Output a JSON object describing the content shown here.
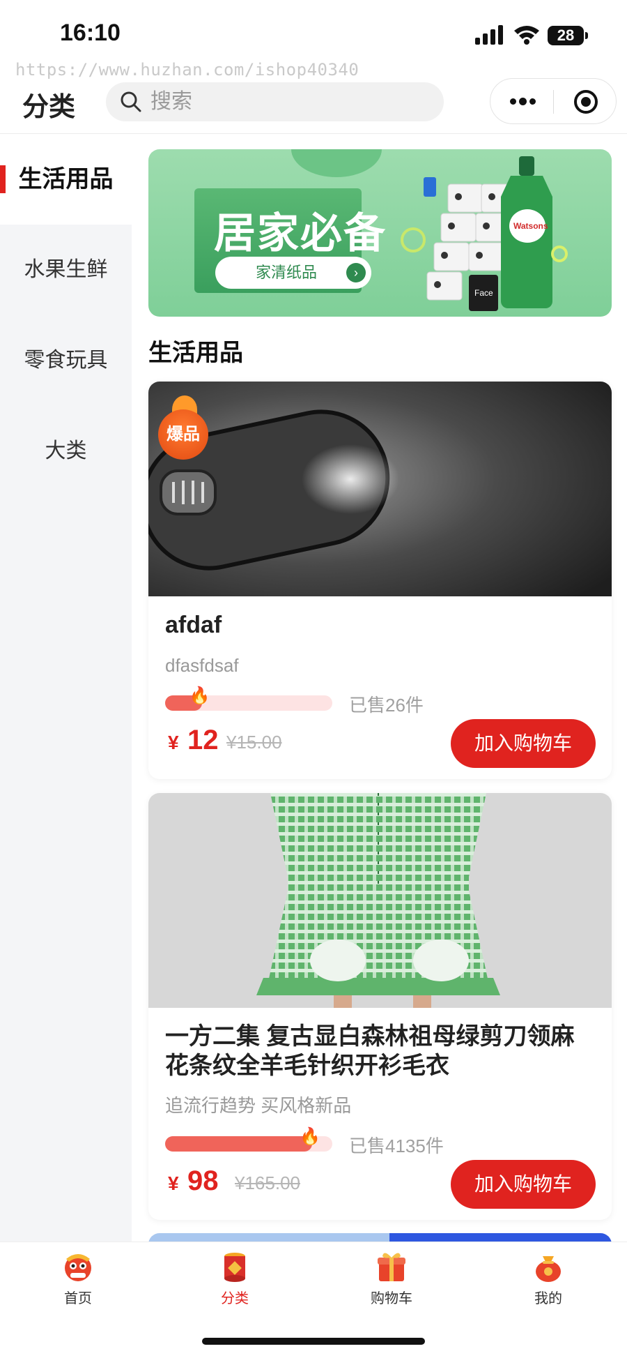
{
  "status_bar": {
    "time": "16:10",
    "battery": "28"
  },
  "watermark": "https://www.huzhan.com/ishop40340",
  "header": {
    "title": "分类",
    "search_placeholder": "搜索"
  },
  "sidebar": {
    "items": [
      {
        "label": "生活用品",
        "active": true
      },
      {
        "label": "水果生鲜",
        "active": false
      },
      {
        "label": "零食玩具",
        "active": false
      },
      {
        "label": "大类",
        "active": false
      }
    ]
  },
  "banner": {
    "title": "居家必备",
    "button_label": "家清纸品",
    "brand_bottle": "Watsons",
    "brand_roll": "Face"
  },
  "section": {
    "title": "生活用品"
  },
  "products": [
    {
      "name": "afdaf",
      "description": "dfasfdsaf",
      "badge": "爆品",
      "sold": "已售26件",
      "sold_progress": 0.22,
      "currency": "¥",
      "price": "12",
      "original_price": "¥15.00",
      "button_label": "加入购物车"
    },
    {
      "name": "一方二集 复古显白森林祖母绿剪刀领麻花条纹全羊毛针织开衫毛衣",
      "description": "追流行趋势 买风格新品",
      "sold": "已售4135件",
      "sold_progress": 0.88,
      "currency": "¥",
      "price": "98",
      "original_price": "¥165.00",
      "button_label": "加入购物车"
    }
  ],
  "tabbar": {
    "items": [
      {
        "label": "首页",
        "icon": "lion-dance-icon",
        "active": false
      },
      {
        "label": "分类",
        "icon": "red-drum-icon",
        "active": true
      },
      {
        "label": "购物车",
        "icon": "gift-box-icon",
        "active": false
      },
      {
        "label": "我的",
        "icon": "lucky-bag-icon",
        "active": false
      }
    ]
  },
  "colors": {
    "accent": "#e0231f",
    "banner_green": "#7fcf98",
    "sidebar_bg": "#f4f5f7"
  }
}
